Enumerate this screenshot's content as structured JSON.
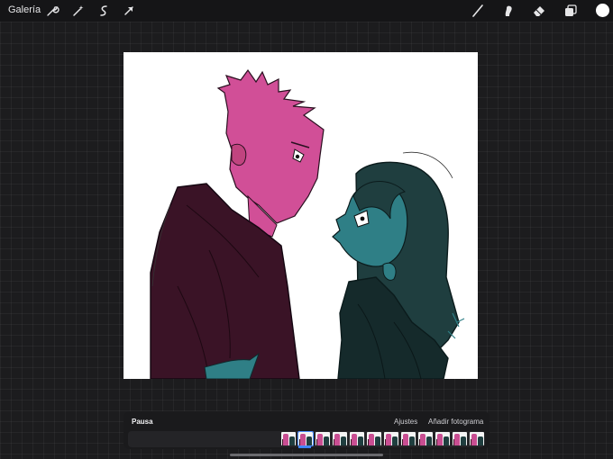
{
  "topbar": {
    "gallery_label": "Galería",
    "left_tools": [
      "wrench-icon",
      "magic-wand-icon",
      "selection-icon",
      "transform-arrow-icon"
    ],
    "right_tools": [
      "brush-icon",
      "smudge-icon",
      "eraser-icon",
      "layers-icon"
    ],
    "current_color": "#ffffff"
  },
  "animation": {
    "pause_label": "Pausa",
    "settings_label": "Ajustes",
    "add_frame_label": "Añadir fotograma",
    "frame_count": 12,
    "active_frame": 2
  },
  "colors": {
    "accent": "#3b82f6",
    "pink_character": "#d14f97",
    "teal_character": "#2f7f86",
    "dark_hoodie": "#3a1326"
  }
}
